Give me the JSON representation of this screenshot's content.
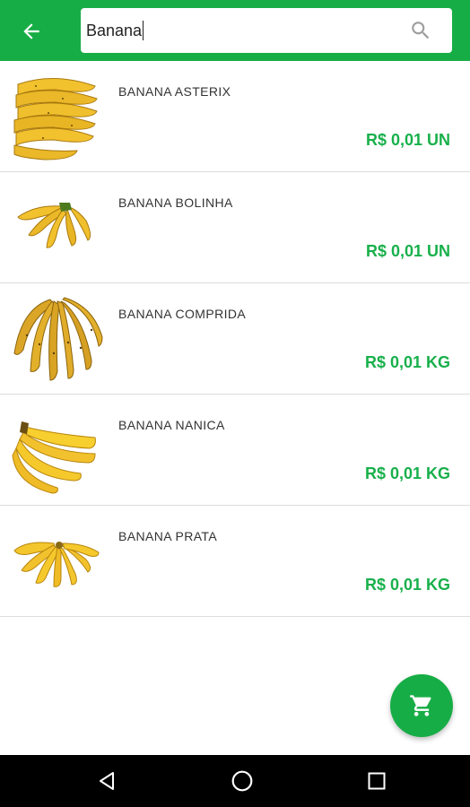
{
  "colors": {
    "primary": "#17ad46",
    "price": "#18b04b",
    "banana_yellow": "#f2c12e",
    "banana_dark": "#c9961a"
  },
  "appbar": {
    "back_icon": "arrow-left-icon",
    "search": {
      "value": "Banana",
      "icon": "search-icon"
    }
  },
  "products": [
    {
      "name": "BANANA ASTERIX",
      "price": "R$ 0,01 UN",
      "image": "banana-asterix-image"
    },
    {
      "name": "BANANA BOLINHA",
      "price": "R$ 0,01 UN",
      "image": "banana-bolinha-image"
    },
    {
      "name": "BANANA COMPRIDA",
      "price": "R$ 0,01 KG",
      "image": "banana-comprida-image"
    },
    {
      "name": "BANANA NANICA",
      "price": "R$ 0,01 KG",
      "image": "banana-nanica-image"
    },
    {
      "name": "BANANA PRATA",
      "price": "R$ 0,01 KG",
      "image": "banana-prata-image"
    }
  ],
  "cart_fab": {
    "icon": "shopping-cart-icon"
  },
  "navbar": {
    "back_icon": "triangle-back-icon",
    "home_icon": "circle-home-icon",
    "recents_icon": "square-recents-icon"
  }
}
